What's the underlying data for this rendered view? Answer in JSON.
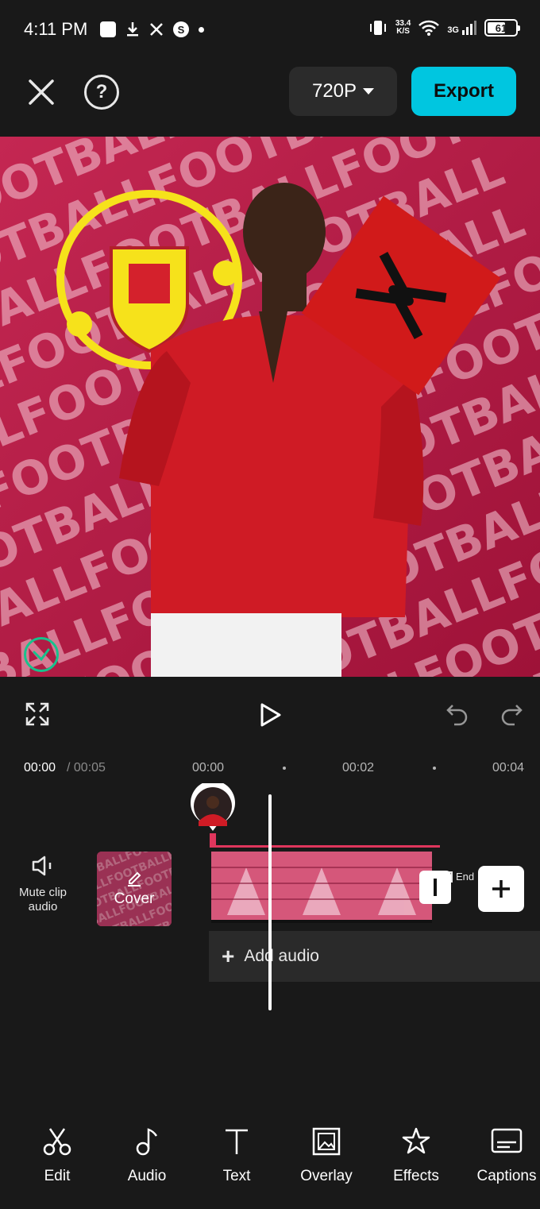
{
  "status_bar": {
    "time": "4:11 PM",
    "net_speed_value": "33.4",
    "net_speed_unit": "K/S",
    "network_type": "3G",
    "battery": "61"
  },
  "toolbar": {
    "resolution": "720P",
    "export_label": "Export",
    "help_glyph": "?"
  },
  "timeline": {
    "current_time": "00:00",
    "total_time": "/ 00:05",
    "ruler": [
      "00:00",
      "00:02",
      "00:04"
    ],
    "mute_label": "Mute clip audio",
    "cover_label": "Cover",
    "end_label": "End",
    "add_audio_label": "Add audio"
  },
  "bottom_tools": [
    {
      "label": "Edit",
      "icon": "scissors-icon"
    },
    {
      "label": "Audio",
      "icon": "music-note-icon"
    },
    {
      "label": "Text",
      "icon": "text-icon"
    },
    {
      "label": "Overlay",
      "icon": "overlay-icon"
    },
    {
      "label": "Effects",
      "icon": "star-icon"
    },
    {
      "label": "Captions",
      "icon": "captions-icon"
    }
  ],
  "colors": {
    "accent": "#00c6e0",
    "clip_accent": "#e0365d",
    "background": "#191919"
  }
}
